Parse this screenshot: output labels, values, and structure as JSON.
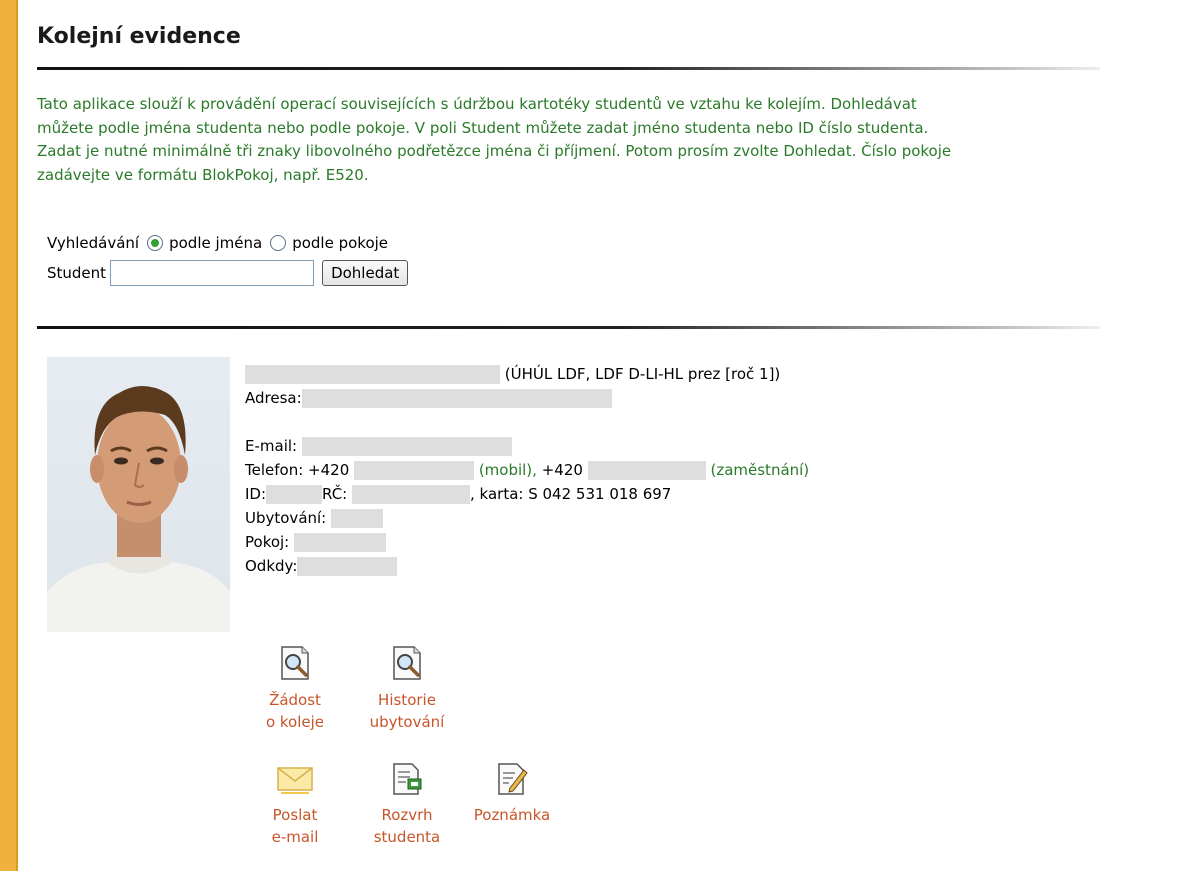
{
  "page": {
    "title": "Kolejní evidence"
  },
  "intro": {
    "lines": [
      "Tato aplikace slouží k provádění operací souvisejících s údržbou kartotéky studentů ve vztahu ke kolejím. Dohledávat",
      "můžete podle jména studenta nebo podle pokoje. V poli Student můžete zadat jméno studenta nebo ID číslo studenta.",
      "Zadat je nutné minimálně tři znaky libovolného podřetězce jména či příjmení. Potom prosím zvolte Dohledat. Číslo pokoje",
      "zadávejte ve formátu BlokPokoj, např. E520."
    ]
  },
  "search": {
    "mode_label": "Vyhledávání",
    "option_name": "podle jména",
    "option_room": "podle pokoje",
    "selected": "podle jména",
    "student_label": "Student",
    "student_value": "",
    "button": "Dohledat"
  },
  "student": {
    "study": "(ÚHÚL LDF, LDF D-LI-HL prez [roč 1])",
    "address_label": "Adresa:",
    "email_label": "E-mail:",
    "phone_label": "Telefon:",
    "phone_prefix1": "+420",
    "phone_type1": "(mobil),",
    "phone_prefix2": "+420",
    "phone_type2": "(zaměstnání)",
    "id_label": "ID:",
    "rc_label": "RČ:",
    "card": ", karta: S 042 531 018 697",
    "housing_label": "Ubytování:",
    "room_label": "Pokoj:",
    "since_label": "Odkdy:"
  },
  "actions": {
    "request": [
      "Žádost",
      "o koleje"
    ],
    "history": [
      "Historie",
      "ubytování"
    ],
    "email": [
      "Poslat",
      "e-mail"
    ],
    "schedule": [
      "Rozvrh",
      "studenta"
    ],
    "note": [
      "Poznámka"
    ]
  },
  "icons": {
    "request": "document-search-icon",
    "history": "document-search-icon",
    "email": "envelope-icon",
    "schedule": "schedule-icon",
    "note": "note-pencil-icon"
  },
  "colors": {
    "accent_bar": "#f0b23c",
    "intro_text": "#2a7a2a",
    "action_link": "#c8552a"
  }
}
